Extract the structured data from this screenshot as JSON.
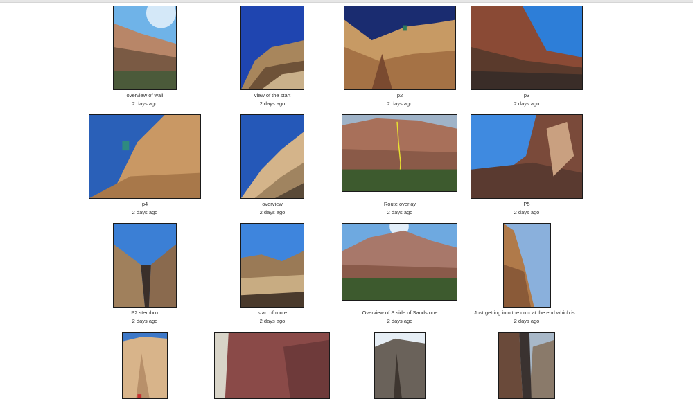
{
  "gallery": {
    "items": [
      {
        "title": "overview of wall",
        "date": "2 days ago"
      },
      {
        "title": "view of the start",
        "date": "2 days ago"
      },
      {
        "title": "p2",
        "date": "2 days ago"
      },
      {
        "title": "p3",
        "date": "2 days ago"
      },
      {
        "title": "p4",
        "date": "2 days ago"
      },
      {
        "title": "overview",
        "date": "2 days ago"
      },
      {
        "title": "Route overlay",
        "date": "2 days ago"
      },
      {
        "title": "P5",
        "date": "2 days ago"
      },
      {
        "title": "P2 stembox",
        "date": "2 days ago"
      },
      {
        "title": "start of route",
        "date": "2 days ago"
      },
      {
        "title": "Overview of S side of Sandstone",
        "date": "2 days ago"
      },
      {
        "title": "Just getting into the crux at the end which is...",
        "date": "2 days ago"
      },
      {
        "title": "",
        "date": ""
      },
      {
        "title": "",
        "date": ""
      },
      {
        "title": "",
        "date": ""
      },
      {
        "title": "",
        "date": ""
      }
    ]
  },
  "colors": {
    "sky": "#2f6fd0",
    "sky_deep": "#1f3f9a",
    "rock_tan": "#c9a070",
    "rock_red": "#8a4a35",
    "rock_dark": "#4a3a30",
    "vegetation": "#3d5a2e"
  }
}
